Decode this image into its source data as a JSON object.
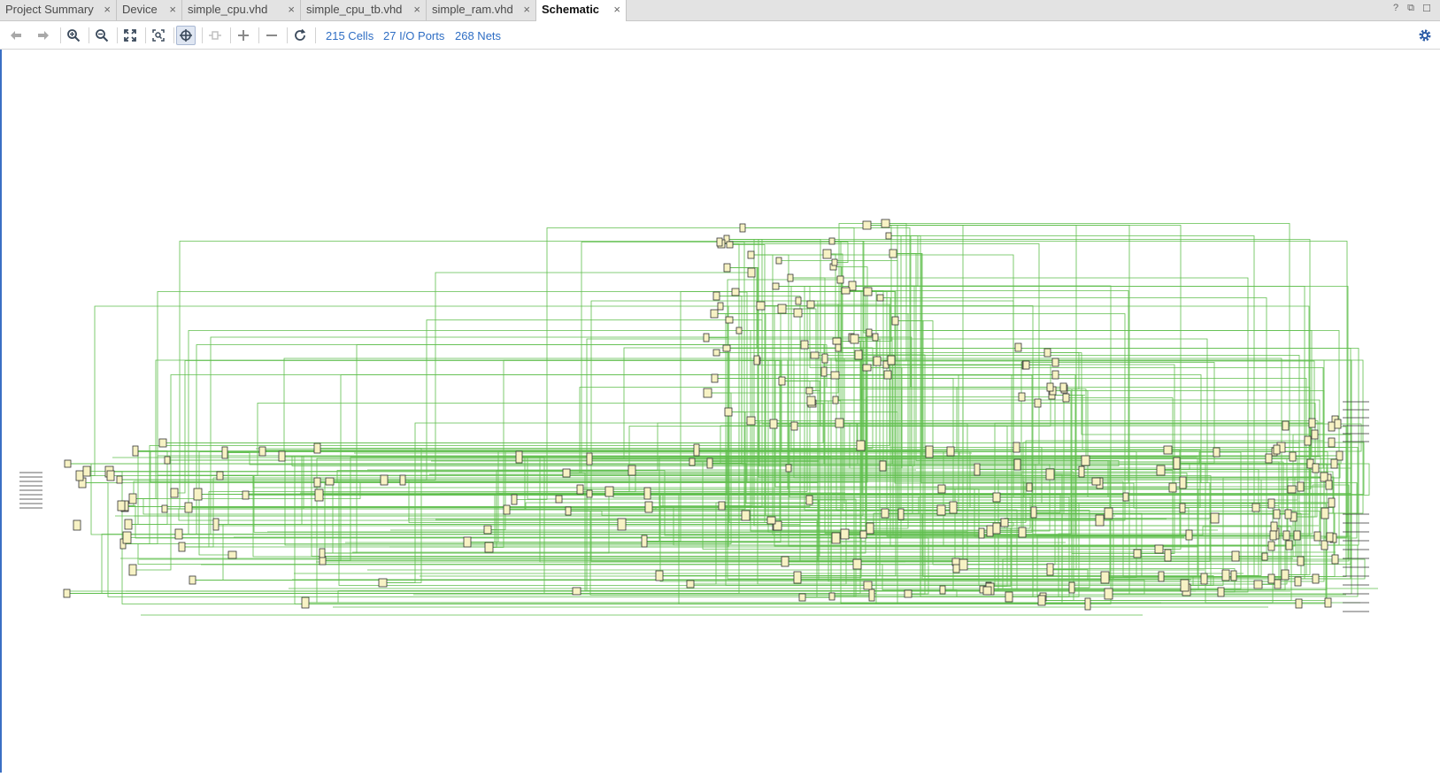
{
  "tabs": [
    {
      "label": "Project Summary",
      "active": false
    },
    {
      "label": "Device",
      "active": false
    },
    {
      "label": "simple_cpu.vhd",
      "active": false
    },
    {
      "label": "simple_cpu_tb.vhd",
      "active": false
    },
    {
      "label": "simple_ram.vhd",
      "active": false
    },
    {
      "label": "Schematic",
      "active": true
    }
  ],
  "tab_close_glyph": "×",
  "window_controls": {
    "help": "?",
    "restore": "⧉",
    "maximize": "☐"
  },
  "toolbar": {
    "icons": [
      "back-arrow-icon",
      "forward-arrow-icon",
      "zoom-in-icon",
      "zoom-out-icon",
      "zoom-fit-icon",
      "zoom-area-icon",
      "route-icon",
      "collapse-icon",
      "expand-plus-icon",
      "collapse-minus-icon",
      "refresh-icon",
      "settings-gear-icon"
    ],
    "stats": {
      "cells": "215 Cells",
      "io_ports": "27 I/O Ports",
      "nets": "268 Nets"
    }
  },
  "colors": {
    "accent": "#2f6ec4",
    "wire": "#5fbf4c",
    "cell_fill": "#f7f2c4",
    "cell_stroke": "#333333",
    "tab_bg": "#e3e3e3"
  }
}
